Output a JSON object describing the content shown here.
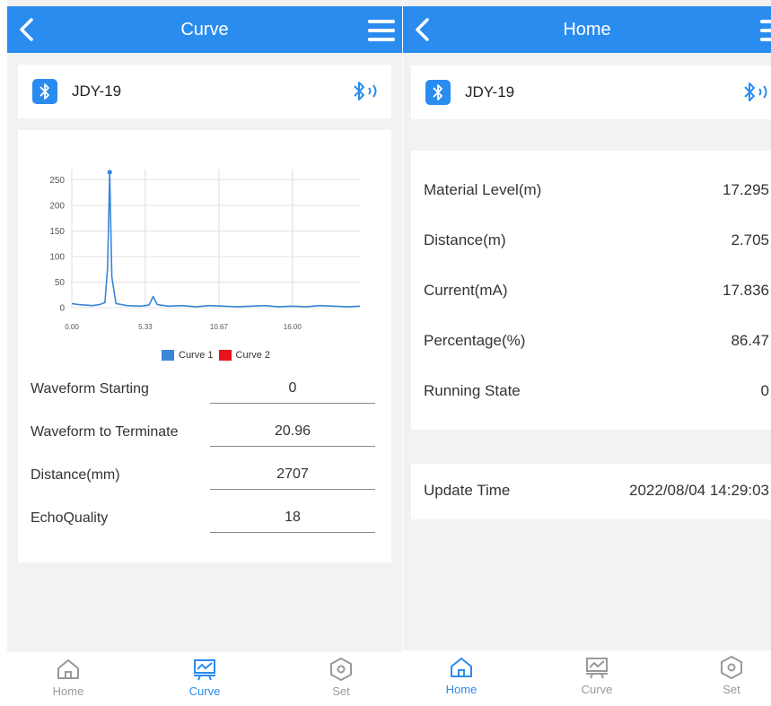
{
  "curve_screen": {
    "title": "Curve",
    "device": {
      "name": "JDY-19"
    },
    "chart_data": {
      "type": "line",
      "x_ticks": [
        "0.00",
        "5.33",
        "10.67",
        "16.00"
      ],
      "y_ticks": [
        "250",
        "200",
        "150",
        "100",
        "50",
        "0"
      ],
      "xlim": [
        0,
        20.96
      ],
      "ylim": [
        0,
        270
      ],
      "grid": true,
      "legend_position": "bottom",
      "series": [
        {
          "name": "Curve 1",
          "color": "#3a86d8",
          "x": [
            0.0,
            0.5,
            1.0,
            1.5,
            2.0,
            2.4,
            2.6,
            2.75,
            2.9,
            3.2,
            4.0,
            5.0,
            5.6,
            5.9,
            6.2,
            7.0,
            8.0,
            9.0,
            10.0,
            11.0,
            12.0,
            13.0,
            14.0,
            15.0,
            16.0,
            17.0,
            18.0,
            19.0,
            20.0,
            20.9
          ],
          "y": [
            8,
            6,
            5,
            4,
            6,
            10,
            80,
            265,
            60,
            8,
            4,
            3,
            5,
            22,
            6,
            3,
            4,
            2,
            4,
            3,
            2,
            3,
            4,
            2,
            3,
            2,
            4,
            3,
            2,
            3
          ]
        },
        {
          "name": "Curve 2",
          "color": "#e8131b",
          "x": [],
          "y": []
        }
      ]
    },
    "fields": [
      {
        "label": "Waveform Starting",
        "value": "0"
      },
      {
        "label": "Waveform to Terminate",
        "value": "20.96"
      },
      {
        "label": "Distance(mm)",
        "value": "2707"
      },
      {
        "label": "EchoQuality",
        "value": "18"
      }
    ],
    "tabs": [
      {
        "label": "Home",
        "active": false
      },
      {
        "label": "Curve",
        "active": true
      },
      {
        "label": "Set",
        "active": false
      }
    ]
  },
  "home_screen": {
    "title": "Home",
    "device": {
      "name": "JDY-19"
    },
    "readings": [
      {
        "label": "Material Level(m)",
        "value": "17.295"
      },
      {
        "label": "Distance(m)",
        "value": "2.705"
      },
      {
        "label": "Current(mA)",
        "value": "17.836"
      },
      {
        "label": "Percentage(%)",
        "value": "86.47"
      },
      {
        "label": "Running State",
        "value": "0"
      }
    ],
    "update": {
      "label": "Update Time",
      "value": "2022/08/04 14:29:03"
    },
    "tabs": [
      {
        "label": "Home",
        "active": true
      },
      {
        "label": "Curve",
        "active": false
      },
      {
        "label": "Set",
        "active": false
      }
    ]
  },
  "colors": {
    "accent": "#2b8cf0",
    "background": "#f2f2f2",
    "inactive_tab": "#999999"
  },
  "icons": [
    "back-arrow-icon",
    "menu-icon",
    "bluetooth-icon",
    "bluetooth-signal-icon",
    "home-icon",
    "curve-icon",
    "settings-hex-icon"
  ]
}
